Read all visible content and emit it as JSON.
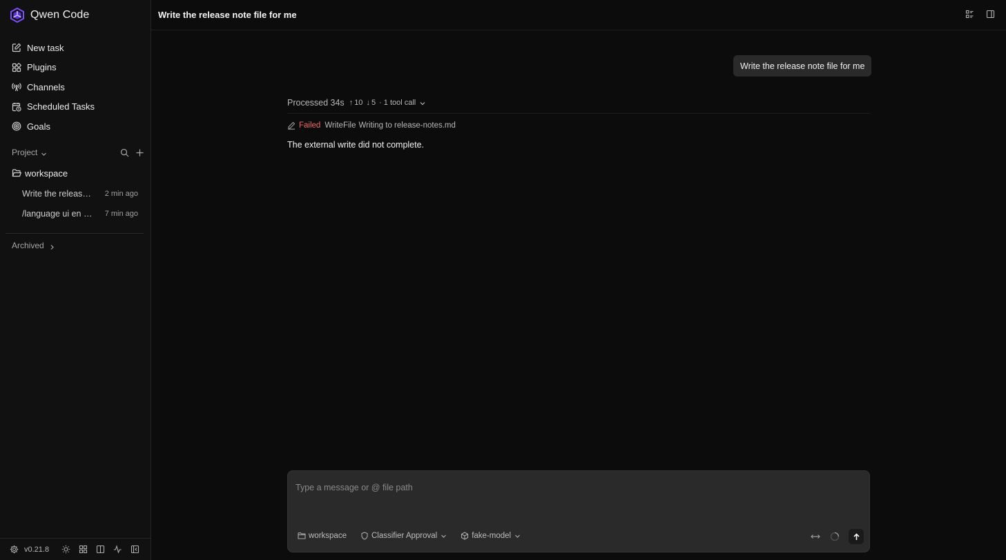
{
  "app": {
    "name": "Qwen Code",
    "version": "v0.21.8"
  },
  "nav": [
    {
      "label": "New task",
      "icon": "edit-icon"
    },
    {
      "label": "Plugins",
      "icon": "plugins-icon"
    },
    {
      "label": "Channels",
      "icon": "broadcast-icon"
    },
    {
      "label": "Scheduled Tasks",
      "icon": "calendar-clock-icon"
    },
    {
      "label": "Goals",
      "icon": "target-icon"
    }
  ],
  "project": {
    "header": "Project",
    "folder": "workspace",
    "sessions": [
      {
        "title": "Write the release note file for me",
        "time": "2 min ago"
      },
      {
        "title": "/language ui en -...",
        "time": "7 min ago"
      }
    ]
  },
  "archived": {
    "label": "Archived"
  },
  "header": {
    "title": "Write the release note file for me"
  },
  "chat": {
    "user_message": "Write the release note file for me",
    "processed": {
      "label": "Processed 34s",
      "up": "10",
      "down": "5",
      "tool_calls": "· 1 tool call"
    },
    "tool": {
      "status": "Failed",
      "name": "WriteFile",
      "detail": "Writing to release-notes.md"
    },
    "answer": "The external write did not complete."
  },
  "composer": {
    "placeholder": "Type a message or @ file path",
    "folder": "workspace",
    "approval": "Classifier Approval",
    "model": "fake-model"
  },
  "colors": {
    "failed": "#ef6b6b",
    "background": "#0c0c0c",
    "sidebar": "#111111",
    "brand": "#7b4dff"
  }
}
